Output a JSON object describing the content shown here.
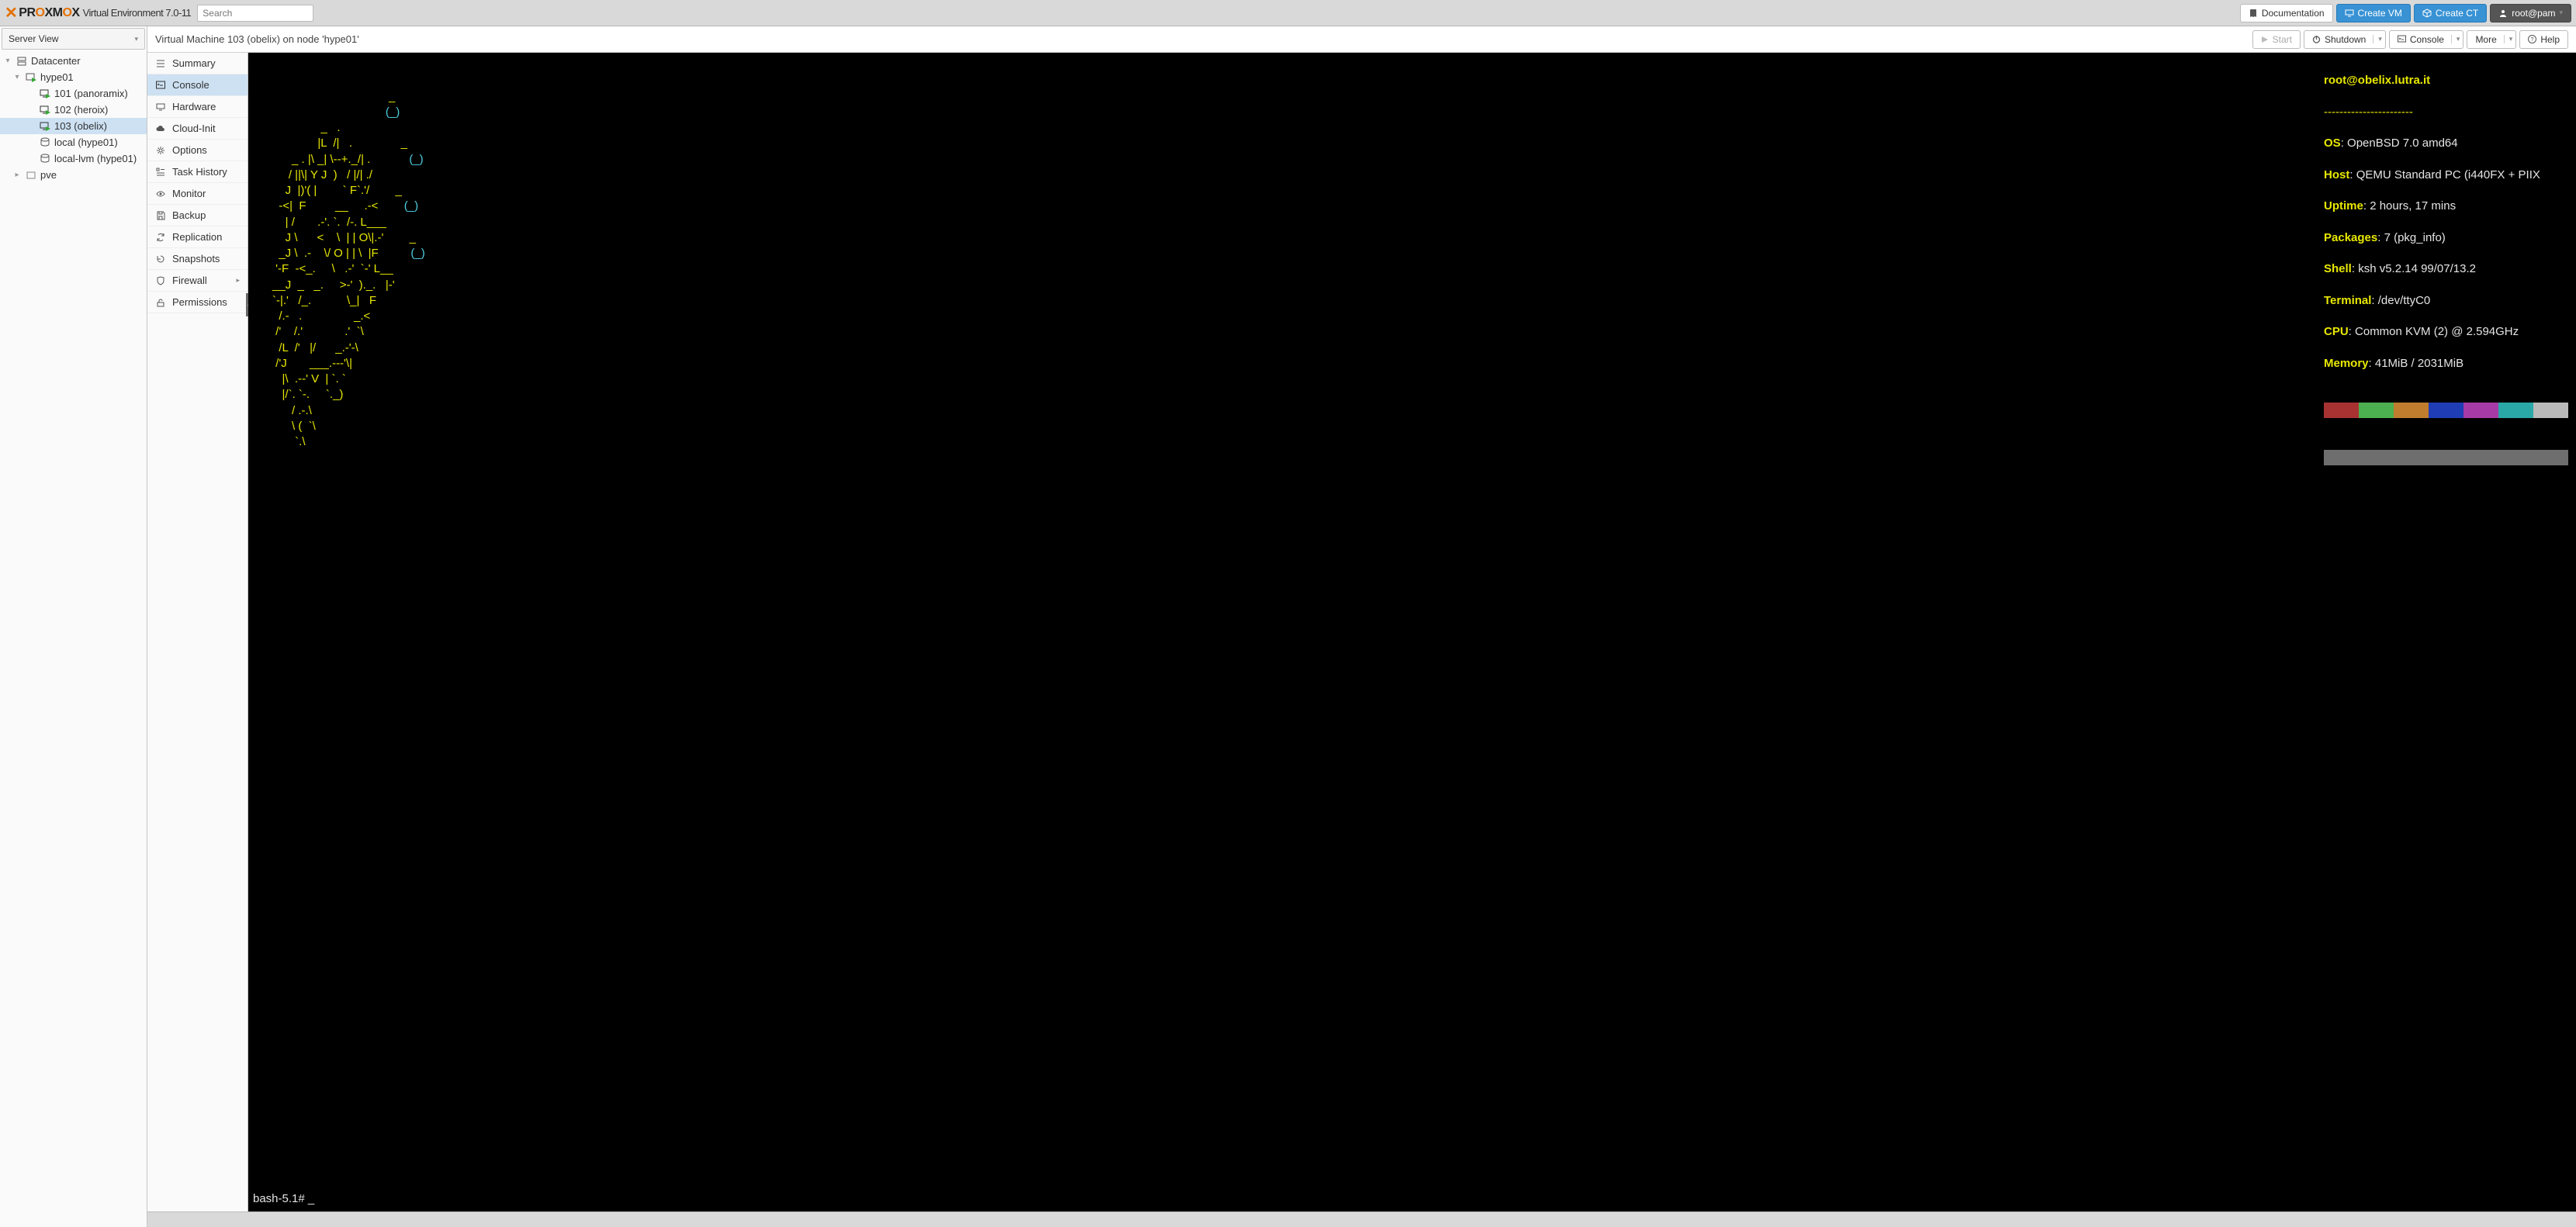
{
  "header": {
    "product": "PROXMOX",
    "subtitle": "Virtual Environment 7.0-11",
    "search_placeholder": "Search",
    "documentation": "Documentation",
    "create_vm": "Create VM",
    "create_ct": "Create CT",
    "user": "root@pam"
  },
  "tree": {
    "view_label": "Server View",
    "nodes": {
      "datacenter": "Datacenter",
      "hype01": "hype01",
      "vm101": "101 (panoramix)",
      "vm102": "102 (heroix)",
      "vm103": "103 (obelix)",
      "local": "local (hype01)",
      "local_lvm": "local-lvm (hype01)",
      "pve": "pve"
    }
  },
  "content": {
    "title": "Virtual Machine 103 (obelix) on node 'hype01'",
    "actions": {
      "start": "Start",
      "shutdown": "Shutdown",
      "console": "Console",
      "more": "More",
      "help": "Help"
    }
  },
  "submenu": {
    "summary": "Summary",
    "console": "Console",
    "hardware": "Hardware",
    "cloudinit": "Cloud-Init",
    "options": "Options",
    "task_history": "Task History",
    "monitor": "Monitor",
    "backup": "Backup",
    "replication": "Replication",
    "snapshots": "Snapshots",
    "firewall": "Firewall",
    "permissions": "Permissions"
  },
  "terminal": {
    "header": "root@obelix.lutra.it",
    "divider": "-----------------------",
    "info": {
      "os_label": "OS",
      "os": "OpenBSD 7.0 amd64",
      "host_label": "Host",
      "host": "QEMU Standard PC (i440FX + PIIX",
      "uptime_label": "Uptime",
      "uptime": "2 hours, 17 mins",
      "packages_label": "Packages",
      "packages": "7 (pkg_info)",
      "shell_label": "Shell",
      "shell": "ksh v5.2.14 99/07/13.2",
      "terminal_label": "Terminal",
      "terminal": "/dev/ttyC0",
      "cpu_label": "CPU",
      "cpu": "Common KVM (2) @ 2.594GHz",
      "memory_label": "Memory",
      "memory": "41MiB / 2031MiB"
    },
    "prompt": "bash-5.1# _",
    "palette_top": [
      "#a83232",
      "#4caf50",
      "#c07d2e",
      "#1f3db5",
      "#a63aa6",
      "#2aa8a8",
      "#bababa"
    ],
    "palette_bottom": "#6e6e6e",
    "ascii_lines": [
      "                                          _",
      "                                         (_)",
      "                     _   .",
      "                    |L  /|   .               _",
      "            _ . |\\ _| \\--+._/| .            (_)",
      "           / ||\\| Y J  )   / |/| ./",
      "          J  |)'( |        ` F`.'/        _",
      "        -<|  F         __     .-<        (_)",
      "          | /       .-'. `.  /-. L___",
      "          J \\      <    \\  | | O\\|.-'        _",
      "        _J \\  .-    \\/ O | | \\  |F          (_)",
      "       '-F  -<_.     \\   .-'  `-' L__",
      "      __J  _   _.     >-'  )._.   |-'",
      "      `-|.'   /_.           \\_|   F",
      "        /.-   .                _.<",
      "       /'    /.'             .'  `\\",
      "        /L  /'   |/      _.-'-\\",
      "       /'J       ___.---'\\|",
      "         |\\  .--' V  | `. `",
      "         |/`. `-.     `._)",
      "            / .-.\\",
      "            \\ (  `\\",
      "             `.\\"
    ]
  }
}
